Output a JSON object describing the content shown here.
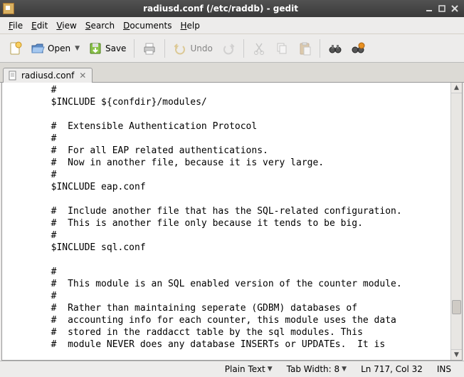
{
  "window": {
    "title": "radiusd.conf (/etc/raddb) - gedit",
    "minimize_tip": "Minimize",
    "maximize_tip": "Maximize",
    "close_tip": "Close"
  },
  "menu": {
    "file": "File",
    "edit": "Edit",
    "view": "View",
    "search": "Search",
    "documents": "Documents",
    "help": "Help"
  },
  "toolbar": {
    "open": "Open",
    "save": "Save",
    "undo": "Undo"
  },
  "tab": {
    "name": "radiusd.conf"
  },
  "editor_text": "        #\n        $INCLUDE ${confdir}/modules/\n\n        #  Extensible Authentication Protocol\n        #\n        #  For all EAP related authentications.\n        #  Now in another file, because it is very large.\n        #\n        $INCLUDE eap.conf\n\n        #  Include another file that has the SQL-related configuration.\n        #  This is another file only because it tends to be big.\n        #\n        $INCLUDE sql.conf\n\n        #\n        #  This module is an SQL enabled version of the counter module.\n        #\n        #  Rather than maintaining seperate (GDBM) databases of\n        #  accounting info for each counter, this module uses the data\n        #  stored in the raddacct table by the sql modules. This\n        #  module NEVER does any database INSERTs or UPDATEs.  It is",
  "status": {
    "lang": "Plain Text",
    "tabwidth": "Tab Width: 8",
    "pos": "Ln 717, Col 32",
    "ins": "INS"
  }
}
